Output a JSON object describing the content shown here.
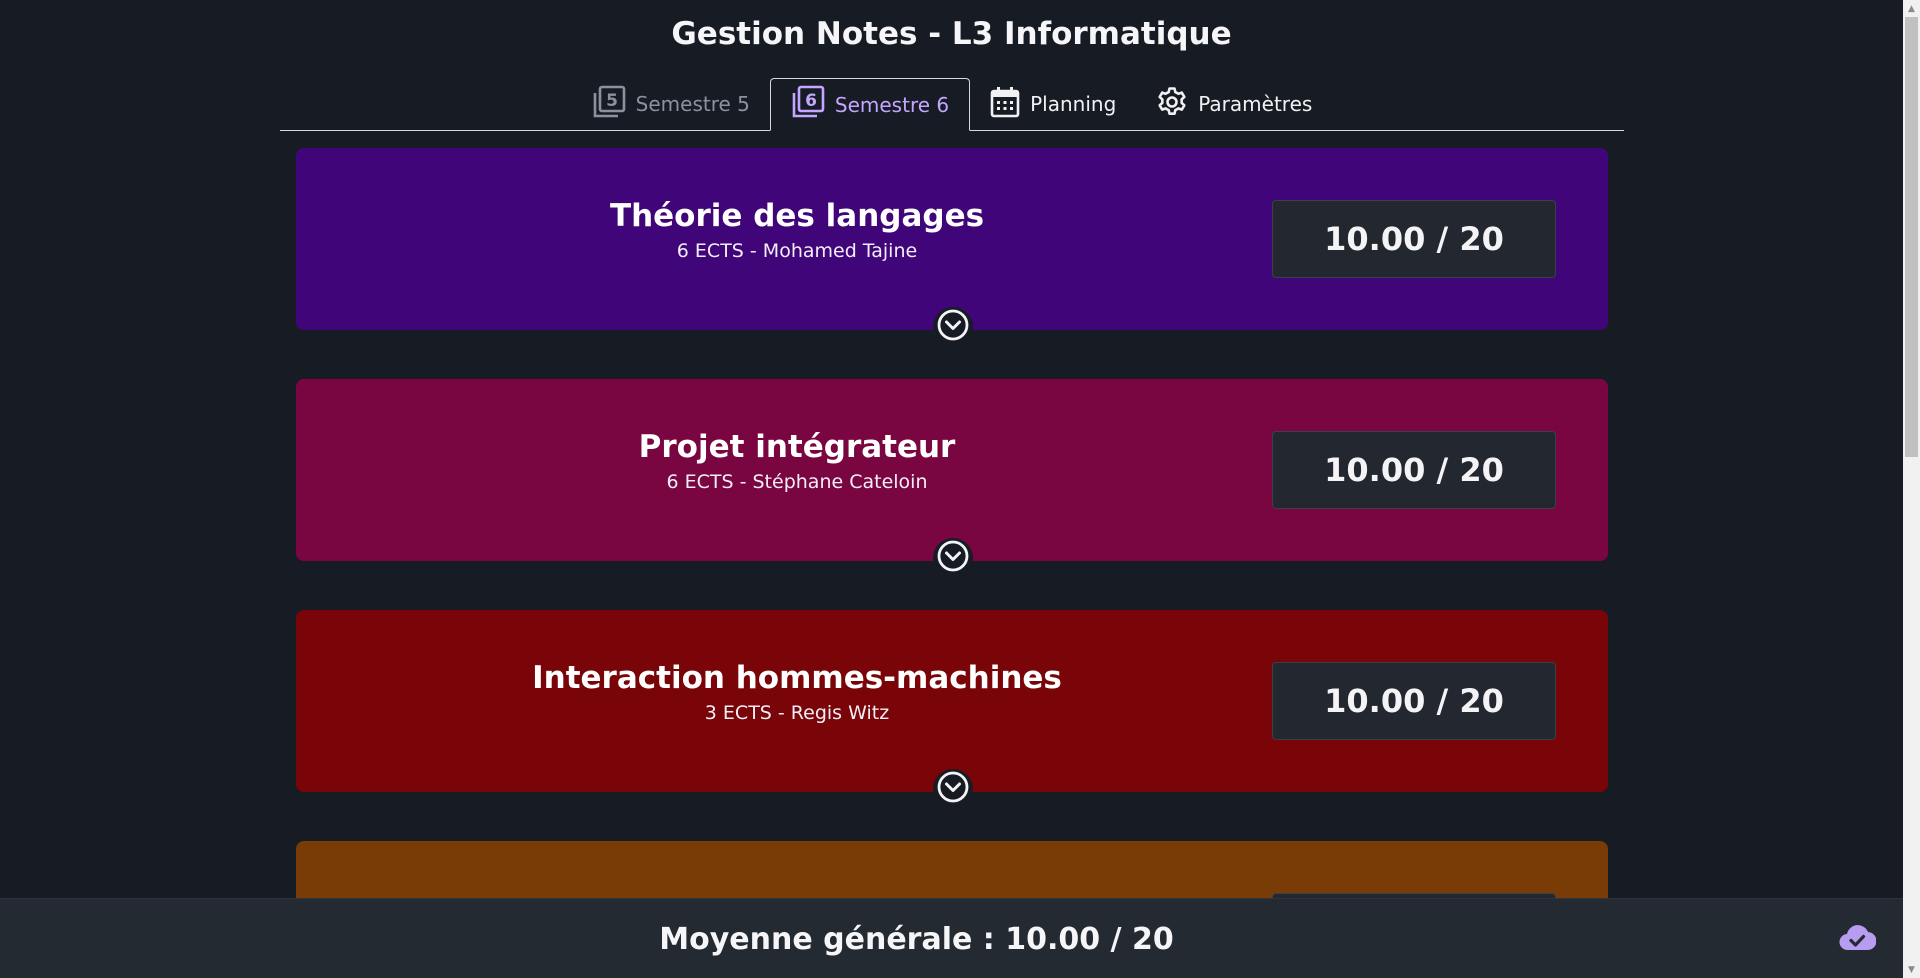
{
  "app": {
    "title": "Gestion Notes - L3 Informatique"
  },
  "tabs": [
    {
      "label": "Semestre 5",
      "icon": "semester-5-icon",
      "state": "inactive"
    },
    {
      "label": "Semestre 6",
      "icon": "semester-6-icon",
      "state": "active"
    },
    {
      "label": "Planning",
      "icon": "calendar-icon",
      "state": "normal"
    },
    {
      "label": "Paramètres",
      "icon": "gear-icon",
      "state": "normal"
    }
  ],
  "courses": [
    {
      "name": "Théorie des langages",
      "meta": "6 ECTS - Mohamed Tajine",
      "grade": "10.00 / 20",
      "color": "#400578"
    },
    {
      "name": "Projet intégrateur",
      "meta": "6 ECTS - Stéphane Cateloin",
      "grade": "10.00 / 20",
      "color": "#790641"
    },
    {
      "name": "Interaction hommes-machines",
      "meta": "3 ECTS - Regis Witz",
      "grade": "10.00 / 20",
      "color": "#790508"
    },
    {
      "name": "",
      "meta": "",
      "grade": "",
      "color": "#793c06"
    }
  ],
  "footer": {
    "average": "Moyenne générale : 10.00 / 20",
    "sync_icon": "cloud-check-icon"
  },
  "colors": {
    "background": "#171c24",
    "accent": "#c3a6ff",
    "grade_box": "#232830"
  }
}
